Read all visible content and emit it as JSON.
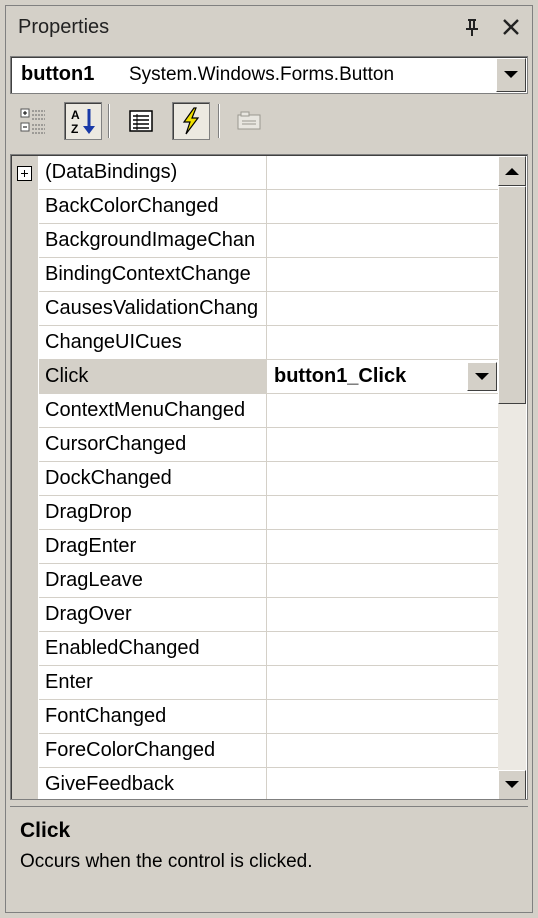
{
  "window": {
    "title": "Properties"
  },
  "object_selector": {
    "name": "button1",
    "type": "System.Windows.Forms.Button"
  },
  "toolbar": {
    "buttons": [
      {
        "icon": "categorized-icon",
        "pressed": false
      },
      {
        "icon": "alphabetical-icon",
        "pressed": true
      },
      {
        "icon": "properties-icon",
        "pressed": false
      },
      {
        "icon": "events-icon",
        "pressed": true
      },
      {
        "icon": "property-pages-icon",
        "pressed": false
      }
    ]
  },
  "events": [
    {
      "name": "(DataBindings)",
      "value": ""
    },
    {
      "name": "BackColorChanged",
      "value": ""
    },
    {
      "name": "BackgroundImageChan",
      "value": ""
    },
    {
      "name": "BindingContextChange",
      "value": ""
    },
    {
      "name": "CausesValidationChang",
      "value": ""
    },
    {
      "name": "ChangeUICues",
      "value": ""
    },
    {
      "name": "Click",
      "value": "button1_Click"
    },
    {
      "name": "ContextMenuChanged",
      "value": ""
    },
    {
      "name": "CursorChanged",
      "value": ""
    },
    {
      "name": "DockChanged",
      "value": ""
    },
    {
      "name": "DragDrop",
      "value": ""
    },
    {
      "name": "DragEnter",
      "value": ""
    },
    {
      "name": "DragLeave",
      "value": ""
    },
    {
      "name": "DragOver",
      "value": ""
    },
    {
      "name": "EnabledChanged",
      "value": ""
    },
    {
      "name": "Enter",
      "value": ""
    },
    {
      "name": "FontChanged",
      "value": ""
    },
    {
      "name": "ForeColorChanged",
      "value": ""
    },
    {
      "name": "GiveFeedback",
      "value": ""
    }
  ],
  "selected_index": 6,
  "description": {
    "title": "Click",
    "text": "Occurs when the control is clicked."
  },
  "colors": {
    "panel": "#d4d0c8",
    "grid_line": "#d4d0c8",
    "selected_name_bg": "#d4d0c8"
  }
}
